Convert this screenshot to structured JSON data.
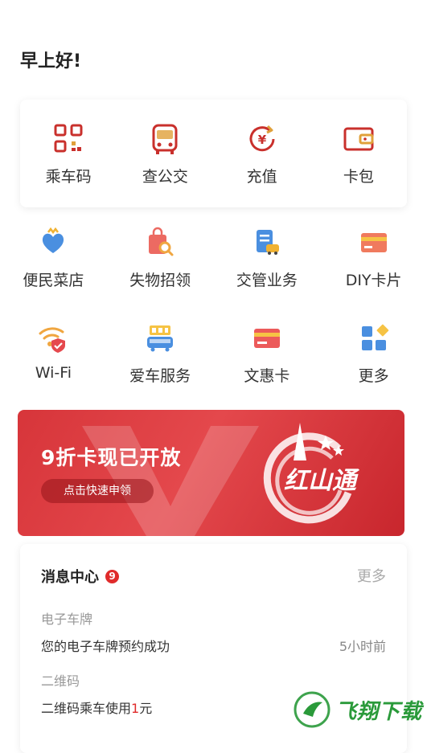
{
  "greeting": "早上好!",
  "quick_actions": [
    {
      "label": "乘车码",
      "icon": "qr-code-icon"
    },
    {
      "label": "查公交",
      "icon": "bus-icon"
    },
    {
      "label": "充值",
      "icon": "yuan-recharge-icon"
    },
    {
      "label": "卡包",
      "icon": "wallet-icon"
    }
  ],
  "services_row1": [
    {
      "label": "便民菜店",
      "icon": "heart-hand-icon"
    },
    {
      "label": "失物招领",
      "icon": "lost-found-icon"
    },
    {
      "label": "交管业务",
      "icon": "traffic-management-icon"
    },
    {
      "label": "DIY卡片",
      "icon": "diy-card-icon"
    }
  ],
  "services_row2": [
    {
      "label": "Wi-Fi",
      "icon": "wifi-shield-icon"
    },
    {
      "label": "爱车服务",
      "icon": "car-service-icon"
    },
    {
      "label": "文惠卡",
      "icon": "culture-card-icon"
    },
    {
      "label": "更多",
      "icon": "more-grid-icon"
    }
  ],
  "banner": {
    "title": "9折卡现已开放",
    "cta": "点击快速申领",
    "logo_text": "红山通"
  },
  "messages": {
    "title": "消息中心",
    "badge": "9",
    "more": "更多",
    "items": [
      {
        "category": "电子车牌",
        "text": "您的电子车牌预约成功",
        "time": "5小时前"
      },
      {
        "category": "二维码",
        "text_prefix": "二维码乘车使用",
        "amount": "1",
        "unit": "元"
      }
    ]
  },
  "watermark": "飞翔下载",
  "colors": {
    "accent": "#d7353a",
    "badge": "#e02b2b"
  }
}
